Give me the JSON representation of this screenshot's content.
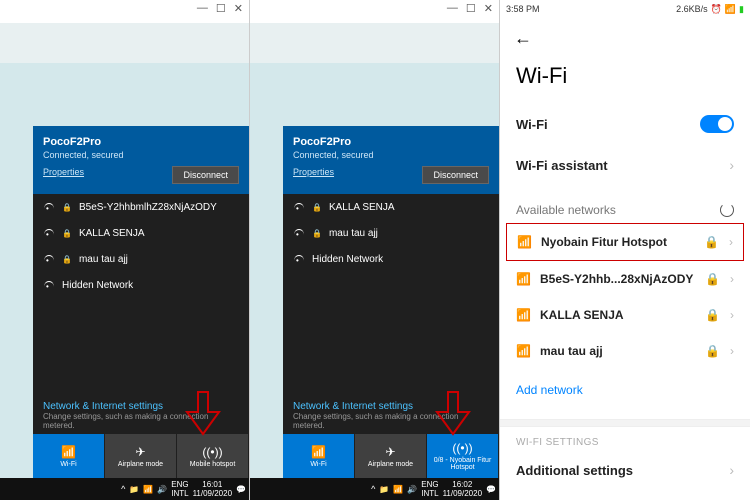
{
  "panels": {
    "left": {
      "connected": {
        "name": "PocoF2Pro",
        "status": "Connected, secured",
        "properties": "Properties",
        "disconnect": "Disconnect"
      },
      "networks": [
        {
          "name": "B5eS-Y2hhbmlhZ28xNjAzODY",
          "locked": true
        },
        {
          "name": "KALLA SENJA",
          "locked": true
        },
        {
          "name": "mau tau ajj",
          "locked": true
        },
        {
          "name": "Hidden Network",
          "locked": false
        }
      ],
      "settings": {
        "title": "Network & Internet settings",
        "sub": "Change settings, such as making a connection metered."
      },
      "tiles": [
        {
          "label": "Wi-Fi",
          "active": true
        },
        {
          "label": "Airplane mode",
          "active": false
        },
        {
          "label": "Mobile hotspot",
          "active": false
        }
      ],
      "tray": {
        "lang": "ENG",
        "kbd": "INTL",
        "time": "16:01",
        "date": "11/09/2020"
      }
    },
    "middle": {
      "connected": {
        "name": "PocoF2Pro",
        "status": "Connected, secured",
        "properties": "Properties",
        "disconnect": "Disconnect"
      },
      "networks": [
        {
          "name": "KALLA SENJA",
          "locked": true
        },
        {
          "name": "mau tau ajj",
          "locked": true
        },
        {
          "name": "Hidden Network",
          "locked": false
        }
      ],
      "settings": {
        "title": "Network & Internet settings",
        "sub": "Change settings, such as making a connection metered."
      },
      "tiles": [
        {
          "label": "Wi-Fi",
          "active": true
        },
        {
          "label": "Airplane mode",
          "active": false
        },
        {
          "label": "0/8 - Nyobain Fitur Hotspot",
          "active": true
        }
      ],
      "tray": {
        "lang": "ENG",
        "kbd": "INTL",
        "time": "16:02",
        "date": "11/09/2020"
      }
    }
  },
  "phone": {
    "status": {
      "time": "3:58 PM",
      "speed": "2.6KB/s"
    },
    "title": "Wi-Fi",
    "rows": {
      "wifi": "Wi-Fi",
      "assistant": "Wi-Fi assistant"
    },
    "available": "Available networks",
    "networks": [
      {
        "name": "Nyobain Fitur Hotspot",
        "locked": true,
        "boxed": true
      },
      {
        "name": "B5eS-Y2hhb...28xNjAzODY",
        "locked": true
      },
      {
        "name": "KALLA SENJA",
        "locked": true
      },
      {
        "name": "mau tau ajj",
        "locked": true
      }
    ],
    "add": "Add network",
    "sect": "WI-FI SETTINGS",
    "additional": "Additional settings"
  }
}
